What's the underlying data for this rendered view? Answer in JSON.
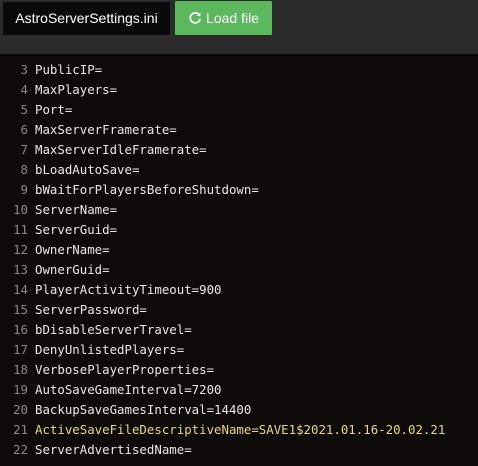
{
  "toolbar": {
    "file_name": "AstroServerSettings.ini",
    "load_label": "Load file",
    "load_icon": "refresh-icon",
    "load_color": "#5cb85c"
  },
  "editor": {
    "highlight_color": "#e6db74",
    "lines": [
      {
        "n": "3",
        "text": "PublicIP="
      },
      {
        "n": "4",
        "text": "MaxPlayers="
      },
      {
        "n": "5",
        "text": "Port="
      },
      {
        "n": "6",
        "text": "MaxServerFramerate="
      },
      {
        "n": "7",
        "text": "MaxServerIdleFramerate="
      },
      {
        "n": "8",
        "text": "bLoadAutoSave="
      },
      {
        "n": "9",
        "text": "bWaitForPlayersBeforeShutdown="
      },
      {
        "n": "10",
        "text": "ServerName="
      },
      {
        "n": "11",
        "text": "ServerGuid="
      },
      {
        "n": "12",
        "text": "OwnerName="
      },
      {
        "n": "13",
        "text": "OwnerGuid="
      },
      {
        "n": "14",
        "text": "PlayerActivityTimeout=900"
      },
      {
        "n": "15",
        "text": "ServerPassword="
      },
      {
        "n": "16",
        "text": "bDisableServerTravel="
      },
      {
        "n": "17",
        "text": "DenyUnlistedPlayers="
      },
      {
        "n": "18",
        "text": "VerbosePlayerProperties="
      },
      {
        "n": "19",
        "text": "AutoSaveGameInterval=7200"
      },
      {
        "n": "20",
        "text": "BackupSaveGamesInterval=14400"
      },
      {
        "n": "21",
        "text": "ActiveSaveFileDescriptiveName=SAVE1$2021.01.16-20.02.21",
        "highlight": true
      },
      {
        "n": "22",
        "text": "ServerAdvertisedName="
      }
    ]
  }
}
